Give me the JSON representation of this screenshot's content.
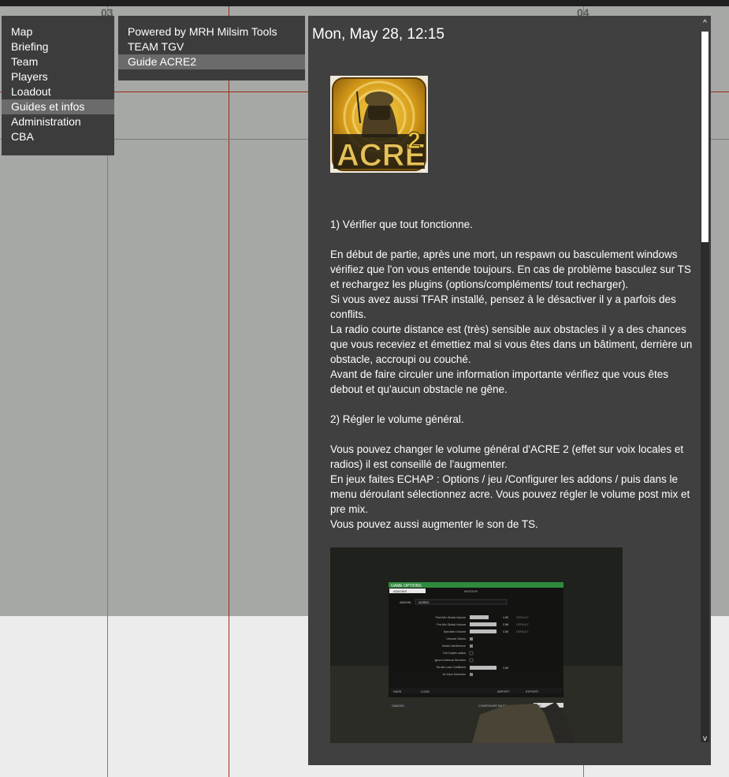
{
  "map": {
    "grid_labels": [
      "03",
      "04"
    ]
  },
  "main_menu": {
    "items": [
      {
        "label": "Map"
      },
      {
        "label": "Briefing"
      },
      {
        "label": "Team"
      },
      {
        "label": "Players"
      },
      {
        "label": "Loadout"
      },
      {
        "label": "Guides et infos",
        "selected": true
      },
      {
        "label": "Administration"
      },
      {
        "label": "CBA"
      }
    ]
  },
  "sub_menu": {
    "items": [
      {
        "label": "Powered by MRH Milsim Tools"
      },
      {
        "label": "TEAM TGV"
      },
      {
        "label": "Guide ACRE2",
        "selected": true
      }
    ]
  },
  "content": {
    "date_title": "Mon, May 28,  12:15",
    "logo_text": "ACRE",
    "logo_number": "2",
    "paragraphs": [
      "1) Vérifier que tout fonctionne.",
      "",
      "En début de partie, après une mort, un respawn ou basculement windows vérifiez que l'on vous entende toujours. En cas de problème basculez sur TS et rechargez les plugins (options/compléments/ tout recharger).",
      "Si vous avez aussi TFAR installé, pensez à le désactiver il y a parfois des conflits.",
      "La radio courte distance est (très) sensible aux obstacles il y a des chances que vous receviez et émettiez  mal si vous êtes dans un bâtiment, derrière un obstacle, accroupi ou couché.",
      "Avant de faire circuler une information importante vérifiez que vous êtes debout et qu'aucun obstacle ne gêne.",
      "",
      "2) Régler le volume général.",
      "",
      "Vous pouvez changer le volume général d'ACRE 2 (effet sur voix locales et radios) il est conseillé de l'augmenter.",
      "En jeux faites ECHAP : Options / jeu /Configurer les addons / puis dans le menu déroulant sélectionnez acre. Vous pouvez régler le volume post mix et pre mix.",
      "Vous pouvez aussi augmenter le son de TS."
    ],
    "screenshot": {
      "window_title": "GAME OPTIONS",
      "tabs": [
        "ADDONS",
        "MISSION"
      ],
      "addon_label": "ADDON",
      "addon_value": "ACRE2",
      "settings": [
        {
          "label": "Post-Mix Global Volume",
          "value": "1.90",
          "default": "DEFAULT"
        },
        {
          "label": "Pre-Mix Global Volume",
          "value": "2.98",
          "default": "DEFAULT"
        },
        {
          "label": "Spectator Volume",
          "value": "1.00",
          "default": "DEFAULT"
        },
        {
          "label": "Unmute Clients",
          "value": "",
          "default": ""
        },
        {
          "label": "Model Interference",
          "value": "",
          "default": ""
        },
        {
          "label": "Full Duplex radios",
          "value": "",
          "default": ""
        },
        {
          "label": "Ignore Antenna Direction",
          "value": "",
          "default": ""
        },
        {
          "label": "Terrain Loss Coefficient",
          "value": "1.00",
          "default": ""
        },
        {
          "label": "AI Voice Detection",
          "value": "",
          "default": ""
        }
      ],
      "footer_buttons": [
        "SAVE",
        "LOAD",
        "IMPORT",
        "EXPORT"
      ],
      "bottom_buttons": [
        "CANCEL",
        "CONFIGURE BASE",
        "OK"
      ]
    }
  },
  "scrollbar": {
    "up": "^",
    "down": "v",
    "position": 0
  },
  "colors": {
    "map_grid_red": "#9c2a1a",
    "map_grid_gray": "#7a7c7a",
    "panel_bg": "#3c3c3c",
    "selected_bg": "#6b6b6b",
    "options_green": "#2e8b3d"
  }
}
